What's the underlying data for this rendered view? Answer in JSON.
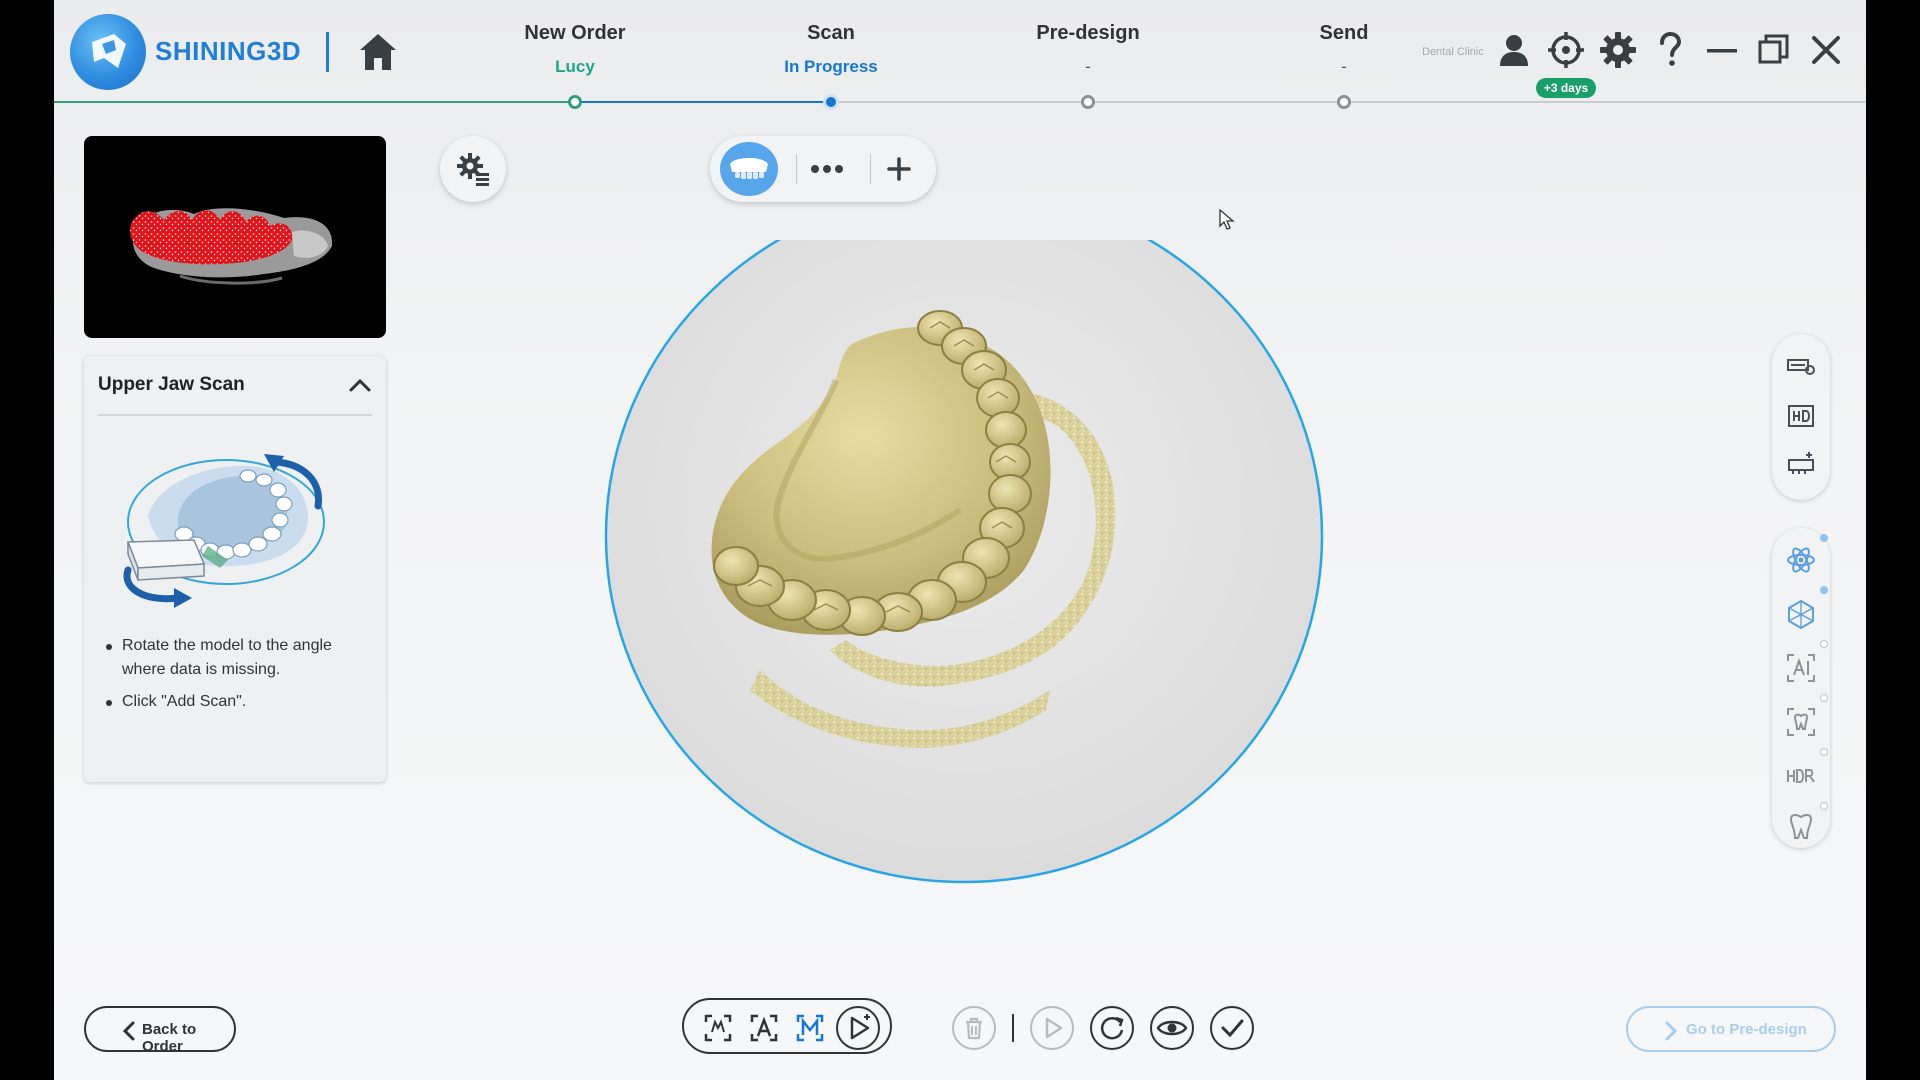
{
  "brand": {
    "name": "SHINING3D"
  },
  "steps": [
    {
      "title": "New Order",
      "sub": "Lucy"
    },
    {
      "title": "Scan",
      "sub": "In Progress"
    },
    {
      "title": "Pre-design",
      "sub": "-"
    },
    {
      "title": "Send",
      "sub": "-"
    }
  ],
  "header": {
    "clinic": "Dental Clinic",
    "badge": "+3 days"
  },
  "guide": {
    "title": "Upper Jaw Scan",
    "tips": [
      "Rotate the model to the angle where data is missing.",
      "Click \"Add Scan\"."
    ]
  },
  "bottom": {
    "back_label": "Back to Order",
    "next_label": "Go to Pre-design"
  },
  "icons": {
    "header": [
      "home-icon",
      "user-icon",
      "crosshair-icon",
      "gear-icon",
      "help-icon",
      "minimize-icon",
      "restore-icon",
      "close-icon"
    ],
    "right_toolbar": [
      "texture-icon",
      "hd-icon",
      "scan-holder-icon",
      "atom-icon",
      "mesh-icon",
      "ai-icon",
      "tooth-scan-icon",
      "hdr-icon",
      "tooth-icon"
    ],
    "bottom": [
      "scan-frame-icon",
      "ai-frame-icon",
      "manual-frame-icon",
      "play-scan-icon",
      "trash-icon",
      "play-icon",
      "refresh-icon",
      "eye-icon",
      "check-icon"
    ]
  },
  "colors": {
    "brand_blue": "#1f7fd6",
    "completed_green": "#1ea58a",
    "active_blue": "#1677d2",
    "model_gold": "#cfc489"
  }
}
